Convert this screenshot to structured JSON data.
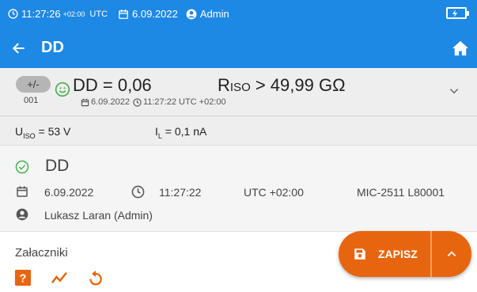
{
  "status_bar": {
    "time": "11:27:26",
    "timezone_small": "+02:00",
    "timezone_label": "UTC",
    "date": "6.09.2022",
    "user": "Admin"
  },
  "title_bar": {
    "title": "DD"
  },
  "summary": {
    "badge": "+/-",
    "index": "001",
    "main_result": "DD = 0,06",
    "riso_prefix": "R",
    "riso_sub": "ISO",
    "riso_value": " > 49,99 GΩ",
    "date": "6.09.2022",
    "time": "11:27:22 UTC +02:00"
  },
  "params": {
    "u_main": "U",
    "u_sub": "ISO",
    "u_value": " = 53 V",
    "i_main": "I",
    "i_sub": "L",
    "i_value": " = 0,1 nA"
  },
  "details": {
    "title": "DD",
    "date": "6.09.2022",
    "time": "11:27:22",
    "timezone": "UTC +02:00",
    "device": "MIC-2511 L80001",
    "user": "Lukasz Laran (Admin)"
  },
  "attachments_label": "Załaczniki",
  "fab": {
    "save_label": "ZAPISZ"
  },
  "colors": {
    "primary": "#1e88e5",
    "accent": "#e8650f",
    "success": "#4caf50"
  }
}
